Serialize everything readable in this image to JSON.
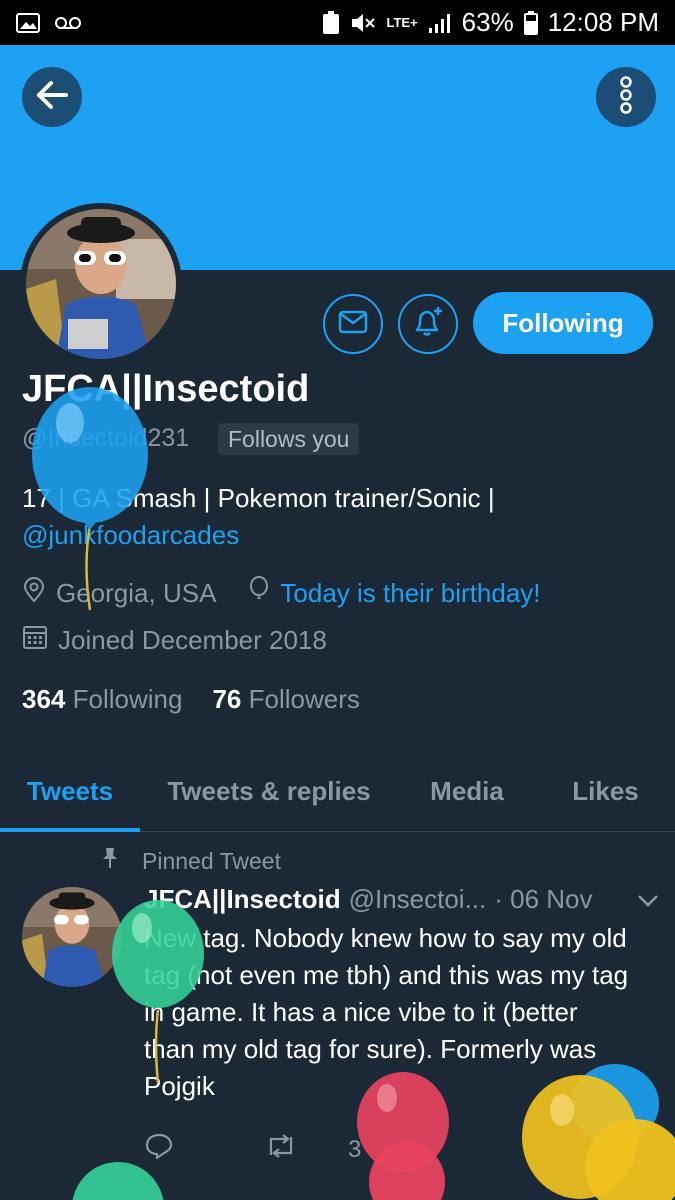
{
  "status_bar": {
    "lte": "LTE+",
    "battery": "63%",
    "time": "12:08 PM"
  },
  "header": {
    "back_icon": "arrow-left-icon",
    "more_icon": "more-vertical-icon"
  },
  "profile": {
    "display_name": "JFCA||Insectoid",
    "handle": "@Insectoid231",
    "follows_you": "Follows you",
    "bio_line1": "17 | GA Smash | Pokemon trainer/Sonic |",
    "bio_mention": "@junkfoodarcades",
    "location": "Georgia, USA",
    "birthday": "Today is their birthday!",
    "joined": "Joined December 2018",
    "following_count": "364",
    "following_label": "Following",
    "followers_count": "76",
    "followers_label": "Followers"
  },
  "actions": {
    "following_button": "Following",
    "message_icon": "envelope-icon",
    "notify_icon": "bell-plus-icon"
  },
  "tabs": [
    {
      "label": "Tweets",
      "active": true
    },
    {
      "label": "Tweets & replies",
      "active": false
    },
    {
      "label": "Media",
      "active": false
    },
    {
      "label": "Likes",
      "active": false
    }
  ],
  "pinned_tweet": {
    "pinned_label": "Pinned Tweet",
    "name": "JFCA||Insectoid",
    "handle": "@Insectoi...",
    "date": "· 06 Nov",
    "text": "New tag. Nobody knew how to say my old tag (not even me tbh) and this was my tag in game. It has a nice vibe to it (better than my old tag for sure). Formerly was Pojgik",
    "retweet_count": "3"
  },
  "colors": {
    "accent": "#1da1f2",
    "background": "#1b2836",
    "muted": "#8899a6"
  }
}
